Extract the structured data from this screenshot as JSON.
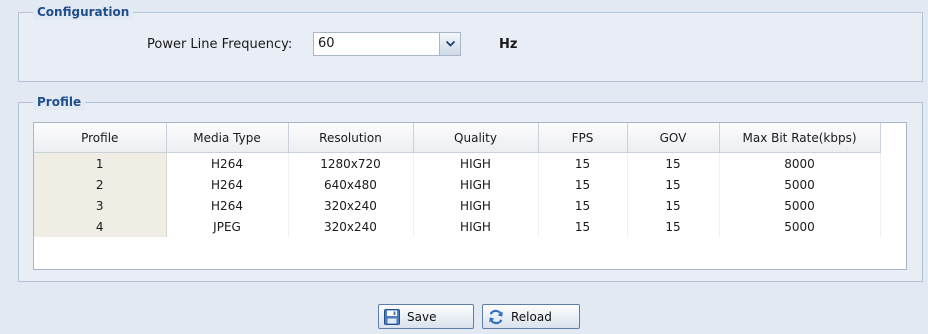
{
  "configuration": {
    "legend": "Configuration",
    "power_line_frequency": {
      "label": "Power Line Frequency:",
      "value": "60",
      "unit": "Hz"
    }
  },
  "profile": {
    "legend": "Profile",
    "columns": [
      "Profile",
      "Media Type",
      "Resolution",
      "Quality",
      "FPS",
      "GOV",
      "Max Bit Rate(kbps)"
    ],
    "rows": [
      [
        "1",
        "H264",
        "1280x720",
        "HIGH",
        "15",
        "15",
        "8000"
      ],
      [
        "2",
        "H264",
        "640x480",
        "HIGH",
        "15",
        "15",
        "5000"
      ],
      [
        "3",
        "H264",
        "320x240",
        "HIGH",
        "15",
        "15",
        "5000"
      ],
      [
        "4",
        "JPEG",
        "320x240",
        "HIGH",
        "15",
        "15",
        "5000"
      ]
    ]
  },
  "buttons": {
    "save": "Save",
    "reload": "Reload"
  },
  "icons": {
    "save": "floppy-disk-icon",
    "reload": "refresh-icon",
    "dropdown": "chevron-down-icon"
  }
}
